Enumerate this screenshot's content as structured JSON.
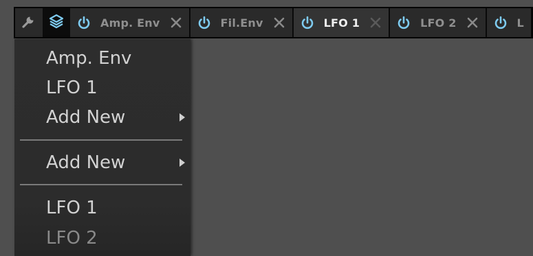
{
  "tabbar": {
    "tools": [
      {
        "icon": "wrench-icon"
      },
      {
        "icon": "layers-icon"
      }
    ],
    "tabs": [
      {
        "label": "Amp. Env",
        "active": false
      },
      {
        "label": "Fil.Env",
        "active": false
      },
      {
        "label": "LFO 1",
        "active": true
      },
      {
        "label": "LFO 2",
        "active": false
      },
      {
        "label": "L",
        "active": false
      }
    ],
    "colors": {
      "power": "#7ecbf0",
      "close": "#8a8a8a",
      "active_close": "#5a5a5a"
    }
  },
  "menu": {
    "items": [
      {
        "label": "Amp. Env"
      },
      {
        "label": "LFO 1"
      },
      {
        "label": "Add New",
        "submenu": true
      },
      {
        "label": "Add New",
        "submenu": true
      },
      {
        "label": "LFO 1"
      },
      {
        "label": "LFO 2",
        "disabled": true
      }
    ]
  }
}
